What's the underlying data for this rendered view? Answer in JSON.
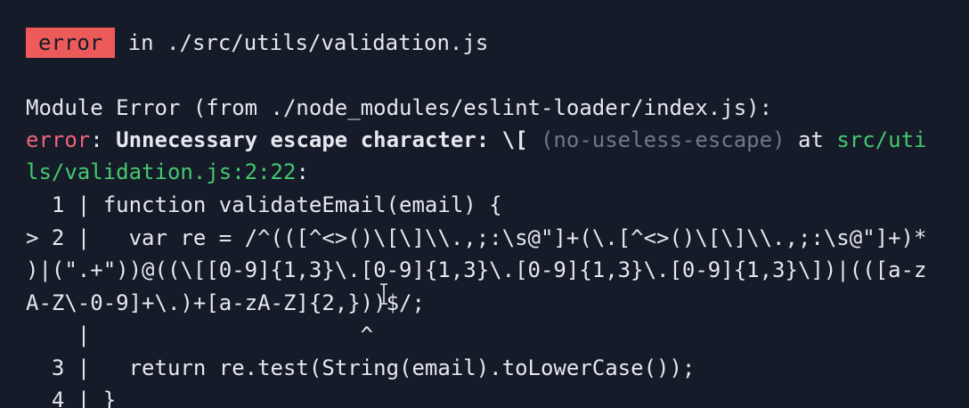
{
  "header": {
    "badge": "error",
    "in_text": " in ./src/utils/validation.js"
  },
  "module_error": "Module Error (from ./node_modules/eslint-loader/index.js):",
  "eslint": {
    "level": "error",
    "sep": ": ",
    "message": "Unnecessary escape character: \\[",
    "space1": " ",
    "rule": "(no-useless-escape)",
    "at": " at ",
    "location_part1": "src/uti",
    "location_part2": "ls/validation.js:2:22",
    "trailing_colon": ":"
  },
  "code_lines": [
    "  1 | function validateEmail(email) {",
    "> 2 |   var re = /^(([^<>()\\[\\]\\\\.,;:\\s@\"]+(\\.[^<>()\\[\\]\\\\.,;:\\s@\"]+)*",
    ")|(\".+\"))@((\\[[0-9]{1,3}\\.[0-9]{1,3}\\.[0-9]{1,3}\\.[0-9]{1,3}\\])|(([a-z",
    "A-Z\\-0-9]+\\.)+[a-zA-Z]{2,}))$/;",
    "    |                     ^",
    "  3 |   return re.test(String(email).toLowerCase());",
    "  4 | }"
  ],
  "colors": {
    "background": "#151b29",
    "badge": "#ec5a5a",
    "error_text": "#f0637a",
    "location": "#45c76e",
    "rule": "#6f7889",
    "text": "#e6e8ee"
  },
  "icons": {
    "cursor": "text-cursor-icon"
  }
}
